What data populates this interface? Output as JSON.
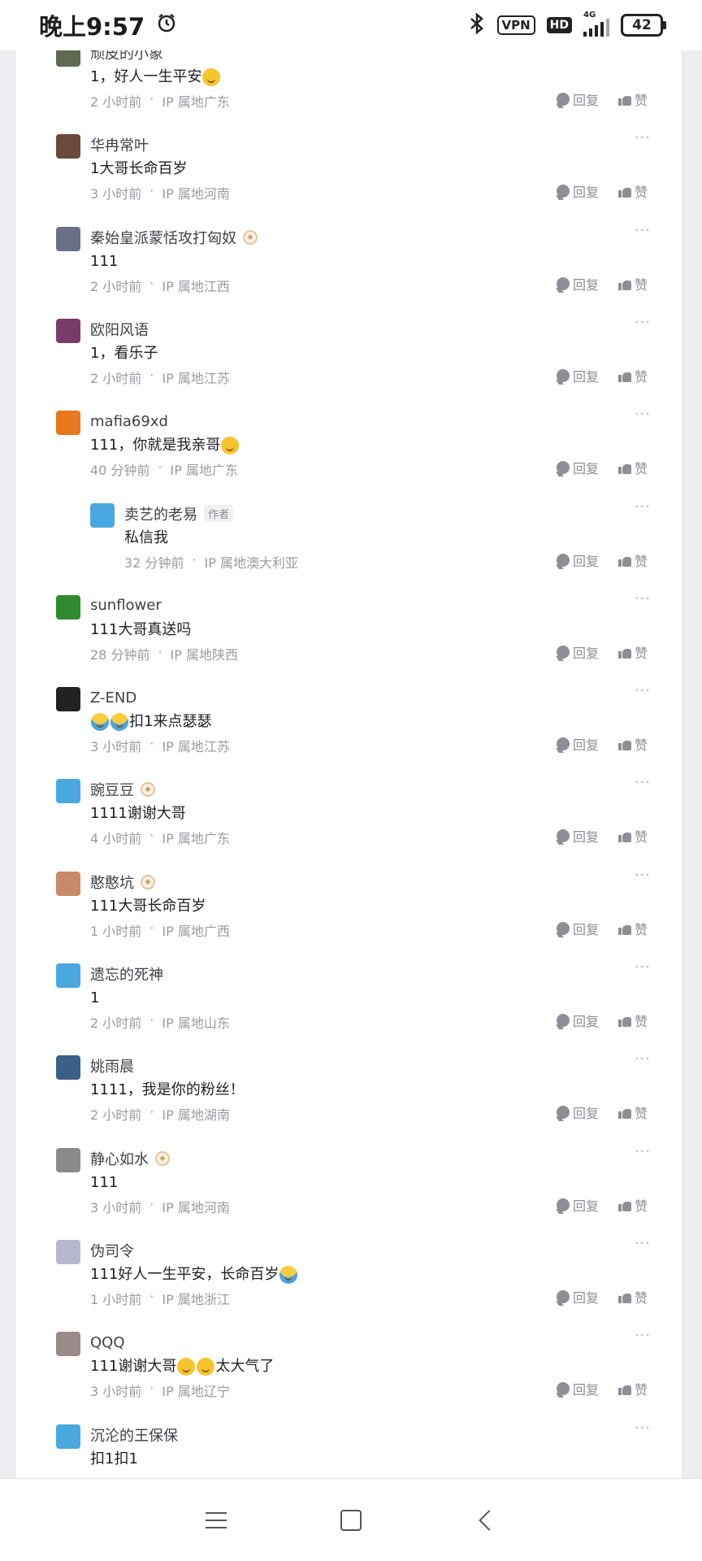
{
  "status_bar": {
    "time": "晚上9:57",
    "vpn": "VPN",
    "hd": "HD",
    "network": "4G",
    "battery": "42"
  },
  "labels": {
    "reply": "回复",
    "like": "赞",
    "more": "···",
    "author_tag": "作者",
    "separator": "·"
  },
  "comments": [
    {
      "name": "顽皮的小象",
      "text": "1，好人一生平安",
      "time": "2 小时前",
      "ip": "IP 属地广东",
      "badge": false,
      "emoji": [
        "laugh"
      ],
      "avatar_color": "#5f6b4f"
    },
    {
      "name": "华冉常叶",
      "text": "1大哥长命百岁",
      "time": "3 小时前",
      "ip": "IP 属地河南",
      "badge": false,
      "avatar_color": "#6b4a3a"
    },
    {
      "name": "秦始皇派蒙恬攻打匈奴",
      "text": "111",
      "time": "2 小时前",
      "ip": "IP 属地江西",
      "badge": true,
      "avatar_color": "#6a6f8a"
    },
    {
      "name": "欧阳风语",
      "text": "1，看乐子",
      "time": "2 小时前",
      "ip": "IP 属地江苏",
      "badge": false,
      "avatar_color": "#7a3b6a"
    },
    {
      "name": "mafia69xd",
      "text": "111，你就是我亲哥",
      "time": "40 分钟前",
      "ip": "IP 属地广东",
      "badge": false,
      "emoji": [
        "laugh"
      ],
      "avatar_color": "#e8771d"
    },
    {
      "name": "卖艺的老易",
      "text": "私信我",
      "time": "32 分钟前",
      "ip": "IP 属地澳大利亚",
      "badge": false,
      "author": true,
      "reply": true,
      "avatar_color": "#4aa8e0"
    },
    {
      "name": "sunflower",
      "text": "111大哥真送吗",
      "time": "28 分钟前",
      "ip": "IP 属地陕西",
      "badge": false,
      "avatar_color": "#2e8b2e"
    },
    {
      "name": "Z-END",
      "text": "扣1来点瑟瑟",
      "time": "3 小时前",
      "ip": "IP 属地江苏",
      "badge": false,
      "emoji_prefix": [
        "blue",
        "blue"
      ],
      "avatar_color": "#222222"
    },
    {
      "name": "豌豆豆",
      "text": "1111谢谢大哥",
      "time": "4 小时前",
      "ip": "IP 属地广东",
      "badge": true,
      "avatar_color": "#4aa8e0"
    },
    {
      "name": "憨憨坑",
      "text": "111大哥长命百岁",
      "time": "1 小时前",
      "ip": "IP 属地广西",
      "badge": true,
      "avatar_color": "#c98a6a"
    },
    {
      "name": "遗忘的死神",
      "text": "1",
      "time": "2 小时前",
      "ip": "IP 属地山东",
      "badge": false,
      "avatar_color": "#4aa8e0"
    },
    {
      "name": "姚雨晨",
      "text": "1111，我是你的粉丝！",
      "time": "2 小时前",
      "ip": "IP 属地湖南",
      "badge": false,
      "avatar_color": "#3c5f8a"
    },
    {
      "name": "静心如水",
      "text": "111",
      "time": "3 小时前",
      "ip": "IP 属地河南",
      "badge": true,
      "avatar_color": "#8a8a8a"
    },
    {
      "name": "伪司令",
      "text": "111好人一生平安，长命百岁",
      "time": "1 小时前",
      "ip": "IP 属地浙江",
      "badge": false,
      "emoji": [
        "blue"
      ],
      "avatar_color": "#b7b7d0"
    },
    {
      "name": "QQQ",
      "text": "111谢谢大哥",
      "text_suffix": "太大气了",
      "time": "3 小时前",
      "ip": "IP 属地辽宁",
      "badge": false,
      "emoji_mid": [
        "laugh",
        "laugh"
      ],
      "avatar_color": "#9a8a8a"
    },
    {
      "name": "沉沦的王保保",
      "text": "扣1扣1",
      "time": "",
      "ip": "",
      "badge": false,
      "avatar_color": "#4aa8e0"
    }
  ]
}
